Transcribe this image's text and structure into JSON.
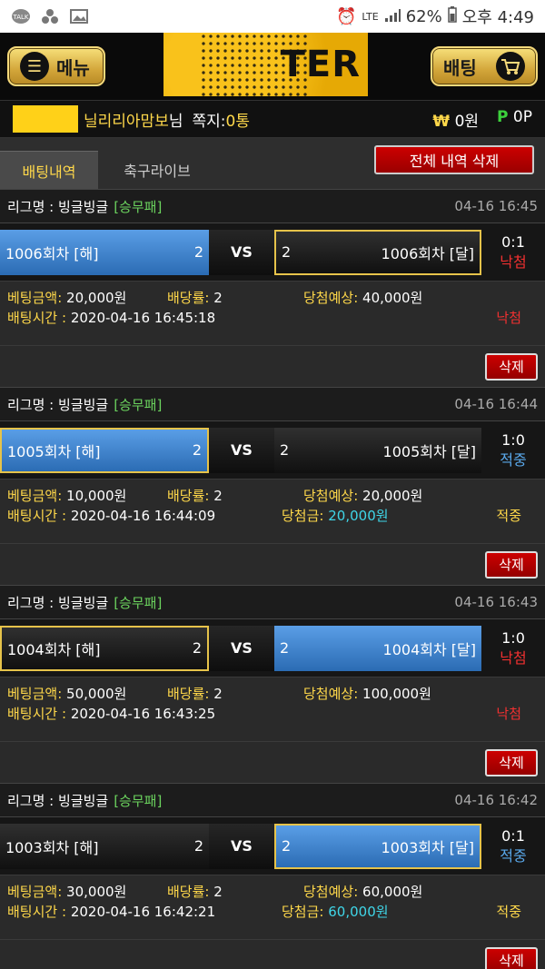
{
  "statusbar": {
    "left_icons": [
      "talk-icon",
      "apps-icon",
      "image-icon"
    ],
    "network": "LTE",
    "battery": "62%",
    "time": "오후 4:49"
  },
  "header": {
    "menu_label": "메뉴",
    "logo_text": "TER",
    "bet_label": "배팅"
  },
  "user": {
    "name": "닐리리아맘보",
    "suffix": "님",
    "notes_label": "쪽지:",
    "notes_count": "0통",
    "won_symbol": "₩",
    "cash": "0원",
    "point_symbol": "P",
    "points": "0P"
  },
  "tabs": {
    "history": "배팅내역",
    "soccer_live": "축구라이브",
    "delete_all": "전체 내역 삭제"
  },
  "bets": [
    {
      "league": "리그명 : 빙글빙글",
      "type": "[승무패]",
      "time": "04-16 16:45",
      "home": "1006회차 [해]",
      "home_odds": "2",
      "vs": "VS",
      "away_odds": "2",
      "away": "1006회차 [달]",
      "score": "0:1",
      "result": "낙첨",
      "amount_label": "베팅금액:",
      "amount": "20,000원",
      "odds_label": "배당률:",
      "odds": "2",
      "expect_label": "당첨예상:",
      "expect": "40,000원",
      "bettime_label": "배팅시간 :",
      "bettime": "2020-04-16 16:45:18",
      "win_label": "",
      "win": "",
      "status": "낙첨",
      "delete": "삭제"
    },
    {
      "league": "리그명 : 빙글빙글",
      "type": "[승무패]",
      "time": "04-16 16:44",
      "home": "1005회차 [해]",
      "home_odds": "2",
      "vs": "VS",
      "away_odds": "2",
      "away": "1005회차 [달]",
      "score": "1:0",
      "result": "적중",
      "amount_label": "베팅금액:",
      "amount": "10,000원",
      "odds_label": "배당률:",
      "odds": "2",
      "expect_label": "당첨예상:",
      "expect": "20,000원",
      "bettime_label": "배팅시간 :",
      "bettime": "2020-04-16 16:44:09",
      "win_label": "당첨금:",
      "win": "20,000원",
      "status": "적중",
      "delete": "삭제"
    },
    {
      "league": "리그명 : 빙글빙글",
      "type": "[승무패]",
      "time": "04-16 16:43",
      "home": "1004회차 [해]",
      "home_odds": "2",
      "vs": "VS",
      "away_odds": "2",
      "away": "1004회차 [달]",
      "score": "1:0",
      "result": "낙첨",
      "amount_label": "베팅금액:",
      "amount": "50,000원",
      "odds_label": "배당률:",
      "odds": "2",
      "expect_label": "당첨예상:",
      "expect": "100,000원",
      "bettime_label": "배팅시간 :",
      "bettime": "2020-04-16 16:43:25",
      "win_label": "",
      "win": "",
      "status": "낙첨",
      "delete": "삭제"
    },
    {
      "league": "리그명 : 빙글빙글",
      "type": "[승무패]",
      "time": "04-16 16:42",
      "home": "1003회차 [해]",
      "home_odds": "2",
      "vs": "VS",
      "away_odds": "2",
      "away": "1003회차 [달]",
      "score": "0:1",
      "result": "적중",
      "amount_label": "베팅금액:",
      "amount": "30,000원",
      "odds_label": "배당률:",
      "odds": "2",
      "expect_label": "당첨예상:",
      "expect": "60,000원",
      "bettime_label": "배팅시간 :",
      "bettime": "2020-04-16 16:42:21",
      "win_label": "당첨금:",
      "win": "60,000원",
      "status": "적중",
      "delete": "삭제"
    }
  ]
}
